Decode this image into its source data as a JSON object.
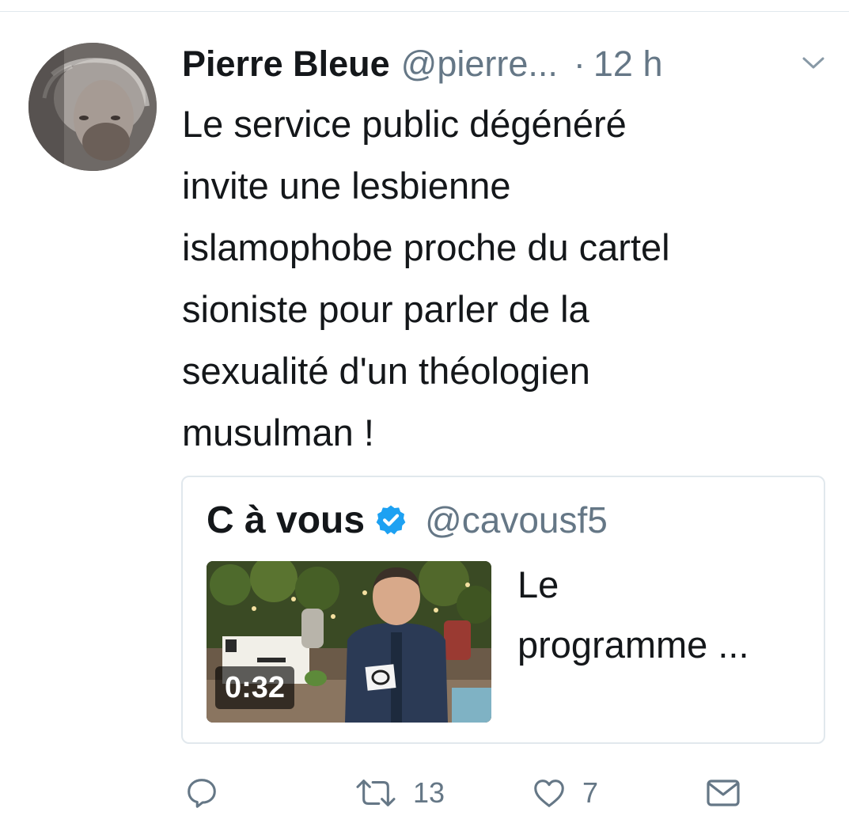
{
  "tweet": {
    "author_name": "Pierre Bleue",
    "author_handle": "@pierre...",
    "separator": "·",
    "time": "12 h",
    "text_lines": [
      "Le service public dégénéré",
      "invite une lesbienne",
      "islamophobe proche du cartel",
      "sioniste pour parler de la",
      "sexualité d'un théologien",
      "musulman !"
    ]
  },
  "quoted": {
    "name": "C à vous",
    "handle": "@cavousf5",
    "video_duration": "0:32",
    "text_lines": [
      "Le",
      "programme ..."
    ]
  },
  "actions": {
    "retweets": "13",
    "likes": "7"
  },
  "colors": {
    "text": "#14171a",
    "muted": "#657786",
    "border": "#e1e8ed",
    "verified": "#1da1f2"
  },
  "icons": [
    "chevron-down-icon",
    "verified-badge-icon",
    "reply-icon",
    "retweet-icon",
    "like-icon",
    "dm-icon"
  ]
}
